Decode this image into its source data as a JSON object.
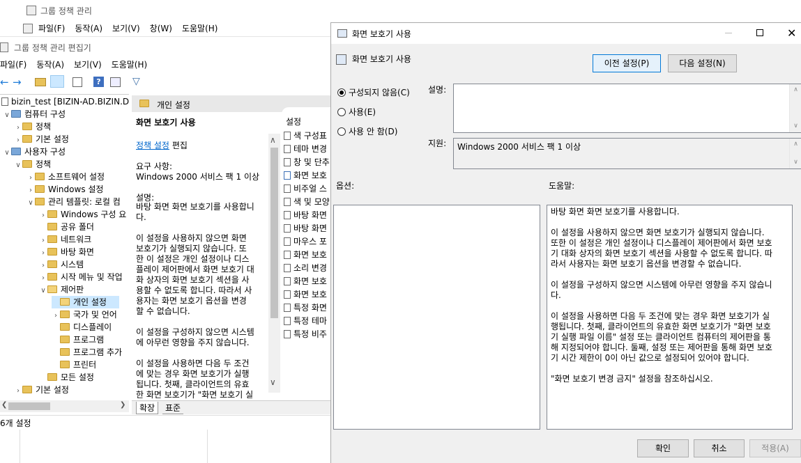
{
  "gpm": {
    "title": "그룹 정책 관리",
    "menu": [
      "파일(F)",
      "동작(A)",
      "보기(V)",
      "창(W)",
      "도움말(H)"
    ]
  },
  "gpe": {
    "title": "그룹 정책 관리 편집기",
    "menu": [
      "파일(F)",
      "동작(A)",
      "보기(V)",
      "도움말(H)"
    ],
    "tree": [
      {
        "label": "bizin_test [BIZIN-AD.BIZIN.DOM"
      },
      {
        "label": "컴퓨터 구성"
      },
      {
        "label": "정책"
      },
      {
        "label": "기본 설정"
      },
      {
        "label": "사용자 구성"
      },
      {
        "label": "정책"
      },
      {
        "label": "소프트웨어 설정"
      },
      {
        "label": "Windows 설정"
      },
      {
        "label": "관리 템플릿: 로컬 컴"
      },
      {
        "label": "Windows 구성 요"
      },
      {
        "label": "공유 폴더"
      },
      {
        "label": "네트워크"
      },
      {
        "label": "바탕 화면"
      },
      {
        "label": "시스템"
      },
      {
        "label": "시작 메뉴 및 작업"
      },
      {
        "label": "제어판"
      },
      {
        "label": "개인 설정"
      },
      {
        "label": "국가 및 언어"
      },
      {
        "label": "디스플레이"
      },
      {
        "label": "프로그램"
      },
      {
        "label": "프로그램 추가"
      },
      {
        "label": "프린터"
      },
      {
        "label": "모든 설정"
      },
      {
        "label": "기본 설정"
      }
    ],
    "desc_header": "개인 설정",
    "desc_title": "화면 보호기 사용",
    "policy_link": "정책 설정",
    "edit_text": "편집",
    "requirement_label": "요구 사항:",
    "requirement_value": "Windows 2000 서비스 팩 1 이상",
    "desc_label": "설명:",
    "desc_text": "바탕 화면 화면 보호기를 사용합니\n다.\n\n이 설정을 사용하지 않으면 화면\n보호기가 실행되지 않습니다. 또\n한 이 설정은 개인 설정이나 디스\n플레이 제어판에서 화면 보호기 대\n화 상자의 화면 보호기 섹션을 사\n용할 수 없도록 합니다. 따라서 사\n용자는 화면 보호기 옵션을 변경\n할 수 없습니다.\n\n이 설정을 구성하지 않으면 시스템\n에 아무런 영향을 주지 않습니다.\n\n이 설정을 사용하면 다음 두 조건\n에 맞는 경우 화면 보호기가 실행\n됩니다. 첫째, 클라이언트의 유효\n한 화면 보호기가 \"화면 보호기 실",
    "list_header": "설정",
    "list_items": [
      "색 구성표",
      "테마 변경",
      "창 및 단추",
      "화면 보호",
      "비주얼 스",
      "색 및 모양",
      "바탕 화면",
      "바탕 화면",
      "마우스 포",
      "화면 보호",
      "소리 변경",
      "화면 보호",
      "화면 보호",
      "특정 화면",
      "특정 테마",
      "특정 비주"
    ],
    "tabs": [
      "확장",
      "표준"
    ],
    "status": "6개 설정"
  },
  "dialog": {
    "title": "화면 보호기 사용",
    "subtitle": "화면 보호기 사용",
    "prev_button": "이전 설정(P)",
    "next_button": "다음 설정(N)",
    "radios": [
      {
        "label": "구성되지 않음(C)",
        "selected": true
      },
      {
        "label": "사용(E)",
        "selected": false
      },
      {
        "label": "사용 안 함(D)",
        "selected": false
      }
    ],
    "comment_label": "설명:",
    "supported_label": "지원:",
    "supported_value": "Windows 2000 서비스 팩 1 이상",
    "options_label": "옵션:",
    "help_label": "도움말:",
    "help_text": "바탕 화면 화면 보호기를 사용합니다.\n\n이 설정을 사용하지 않으면 화면 보호기가 실행되지 않습니다.\n또한 이 설정은 개인 설정이나 디스플레이 제어판에서 화면 보호\n기 대화 상자의 화면 보호기 섹션을 사용할 수 없도록 합니다. 따\n라서 사용자는 화면 보호기 옵션을 변경할 수 없습니다.\n\n이 설정을 구성하지 않으면 시스템에 아무런 영향을 주지 않습니\n다.\n\n이 설정을 사용하면 다음 두 조건에 맞는 경우 화면 보호기가 실\n행됩니다. 첫째, 클라이언트의 유효한 화면 보호기가 \"화면 보호\n기 실행 파일 이름\" 설정 또는 클라이언트 컴퓨터의 제어판을 통\n해 지정되어야 합니다. 둘째, 설정 또는 제어판을 통해 화면 보호\n기 시간 제한이 0이 아닌 값으로 설정되어 있어야 합니다.\n\n\"화면 보호기 변경 금지\" 설정을 참조하십시오.",
    "ok_button": "확인",
    "cancel_button": "취소",
    "apply_button": "적용(A)"
  },
  "colors": {
    "selected": "#cce8ff",
    "link": "#0066cc"
  }
}
